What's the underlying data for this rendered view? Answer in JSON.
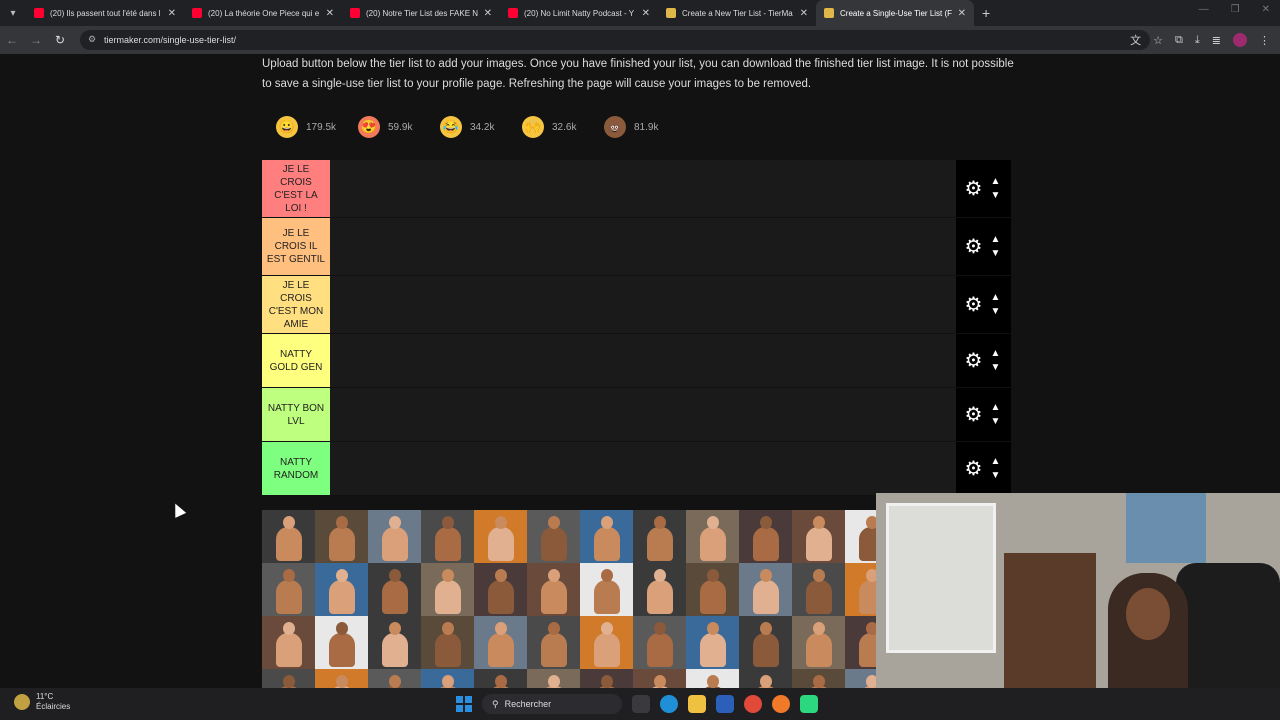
{
  "browser": {
    "tabs": [
      {
        "title": "(20) Ils passent tout l'été dans l",
        "type": "yt",
        "active": false
      },
      {
        "title": "(20) La théorie One Piece qui e",
        "type": "yt",
        "active": false
      },
      {
        "title": "(20) Notre Tier List des FAKE N",
        "type": "yt",
        "active": false
      },
      {
        "title": "(20) No Limit Natty Podcast - Y",
        "type": "yt",
        "active": false
      },
      {
        "title": "Create a New Tier List - TierMa",
        "type": "tm",
        "active": false
      },
      {
        "title": "Create a Single-Use Tier List (Fr",
        "type": "tm",
        "active": true
      }
    ],
    "url": "tiermaker.com/single-use-tier-list/"
  },
  "page": {
    "intro_line1": "Upload button below the tier list to add your images. Once you have finished your list, you can download the finished tier list image. It is not possible",
    "intro_line2": "to save a single-use tier list to your profile page. Refreshing the page will cause your images to be removed."
  },
  "reactions": [
    {
      "emoji": "😀",
      "count": "179.5k",
      "color": "#f5c542"
    },
    {
      "emoji": "😍",
      "count": "59.9k",
      "color": "#f07a5a"
    },
    {
      "emoji": "😂",
      "count": "34.2k",
      "color": "#f5c542"
    },
    {
      "emoji": "🙌",
      "count": "32.6k",
      "color": "#f5c542"
    },
    {
      "emoji": "💩",
      "count": "81.9k",
      "color": "#8a5a3a"
    }
  ],
  "tiers": [
    {
      "label": "JE LE CROIS C'EST LA LOI !",
      "color": "#ff7f7f"
    },
    {
      "label": "JE LE CROIS IL EST GENTIL",
      "color": "#ffbf7f"
    },
    {
      "label": "JE LE CROIS C'EST MON AMIE",
      "color": "#ffdf7f"
    },
    {
      "label": "NATTY GOLD GEN",
      "color": "#ffff7f"
    },
    {
      "label": "NATTY BON LVL",
      "color": "#bfff7f"
    },
    {
      "label": "NATTY RANDOM",
      "color": "#7fff7f"
    }
  ],
  "taskbar": {
    "temperature": "11°C",
    "weather": "Éclaircies",
    "search_placeholder": "Rechercher"
  },
  "icons": {
    "gear": "gear-icon",
    "up": "chevron-up-icon",
    "down": "chevron-down-icon"
  }
}
